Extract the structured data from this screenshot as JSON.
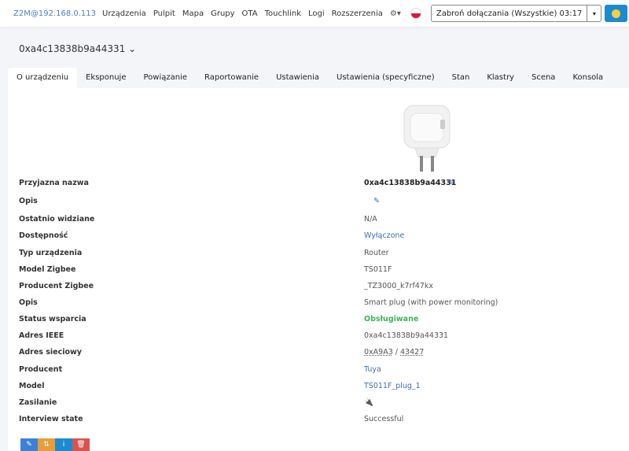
{
  "nav": {
    "brand": "Z2M@192.168.0.113",
    "items": [
      "Urządzenia",
      "Pulpit",
      "Mapa",
      "Grupy",
      "OTA",
      "Touchlink",
      "Logi",
      "Rozszerzenia"
    ],
    "permit_join": "Zabroń dołączania (Wszystkie) 03:17"
  },
  "device": {
    "title": "0xa4c13838b9a44331"
  },
  "tabs": [
    "O urządzeniu",
    "Eksponuje",
    "Powiązanie",
    "Raportowanie",
    "Ustawienia",
    "Ustawienia (specyficzne)",
    "Stan",
    "Klastry",
    "Scena",
    "Konsola"
  ],
  "rows": [
    {
      "label": "Przyjazna nazwa",
      "value": "0xa4c13838b9a44331"
    },
    {
      "label": "Opis",
      "value": ""
    },
    {
      "label": "Ostatnio widziane",
      "value": "N/A"
    },
    {
      "label": "Dostępność",
      "value": "Wyłączone"
    },
    {
      "label": "Typ urządzenia",
      "value": "Router"
    },
    {
      "label": "Model Zigbee",
      "value": "TS011F"
    },
    {
      "label": "Producent Zigbee",
      "value": "_TZ3000_k7rf47kx"
    },
    {
      "label": "Opis",
      "value": "Smart plug (with power monitoring)"
    },
    {
      "label": "Status wsparcia",
      "value": "Obsługiwane"
    },
    {
      "label": "Adres IEEE",
      "value": "0xa4c13838b9a44331"
    },
    {
      "label": "Adres sieciowy",
      "value_hex": "0xA9A3",
      "sep": " / ",
      "value_dec": "43427"
    },
    {
      "label": "Producent",
      "value": "Tuya"
    },
    {
      "label": "Model",
      "value": "TS011F_plug_1"
    },
    {
      "label": "Zasilanie",
      "value": "🔌"
    },
    {
      "label": "Interview state",
      "value": "Successful"
    }
  ],
  "colors": {
    "accent": "#3f6fb8",
    "success": "#3db35a",
    "edit": "#3b82d6",
    "reconfigure": "#e89c3a",
    "info": "#1b8ad1",
    "delete": "#d9534f"
  }
}
